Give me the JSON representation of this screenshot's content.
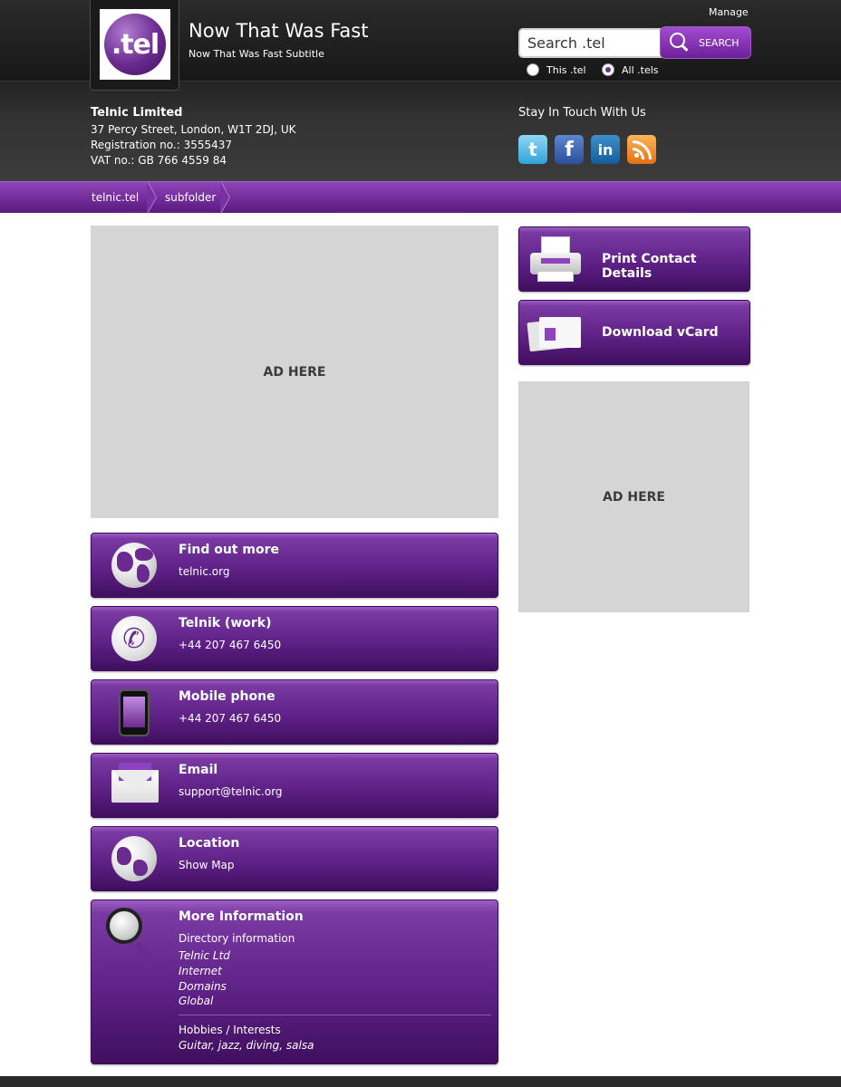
{
  "header": {
    "logo_text": ".tel",
    "title": "Now That Was Fast",
    "subtitle": "Now That Was Fast Subtitle",
    "manage_label": "Manage",
    "search": {
      "placeholder": "Search .tel",
      "button_label": "SEARCH",
      "scope_options": [
        {
          "label": "This .tel",
          "checked": false
        },
        {
          "label": "All .tels",
          "checked": true
        }
      ]
    }
  },
  "company": {
    "name": "Telnic Limited",
    "address": "37 Percy Street, London, W1T 2DJ, UK",
    "registration": "Registration no.: 3555437",
    "vat": "VAT no.: GB 766 4559 84"
  },
  "social": {
    "title": "Stay In Touch With Us",
    "icons": [
      "twitter-icon",
      "facebook-icon",
      "linkedin-icon",
      "rss-icon"
    ],
    "twitter_glyph": "t",
    "facebook_glyph": "f",
    "linkedin_glyph": "in"
  },
  "breadcrumb": [
    "telnic.tel",
    "subfolder"
  ],
  "ads": {
    "main": "AD HERE",
    "side": "AD HERE"
  },
  "actions": {
    "print": "Print Contact Details",
    "vcard": "Download vCard"
  },
  "contacts": [
    {
      "title": "Find out more",
      "value": "telnic.org",
      "icon": "globe-icon"
    },
    {
      "title": "Telnik (work)",
      "value": "+44 207 467 6450",
      "icon": "phone-icon"
    },
    {
      "title": "Mobile phone",
      "value": "+44 207 467 6450",
      "icon": "mobile-phone-icon"
    },
    {
      "title": "Email",
      "value": "support@telnic.org",
      "icon": "envelope-icon"
    },
    {
      "title": "Location",
      "value": "Show Map",
      "icon": "location-globe-icon"
    }
  ],
  "more_info": {
    "title": "More Information",
    "directory_label": "Directory information",
    "directory_items": [
      "Telnic Ltd",
      "Internet",
      "Domains",
      "Global"
    ],
    "hobbies_label": "Hobbies / Interests",
    "hobbies_value": "Guitar, jazz, diving, salsa"
  },
  "colors": {
    "accent_purple": "#6b2a8f",
    "header_dark": "#1c1c1c",
    "ad_gray": "#d5d5d5"
  }
}
